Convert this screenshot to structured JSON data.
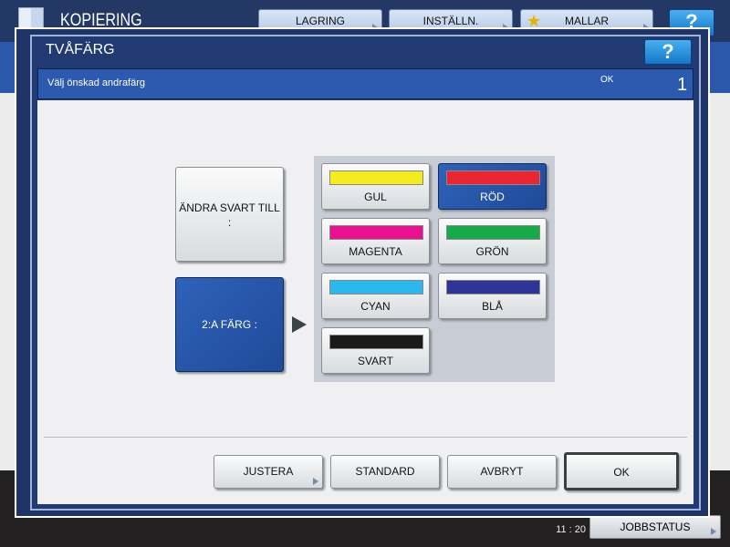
{
  "app": {
    "title": "KOPIERING",
    "icon": "copy-icon"
  },
  "toolbar": {
    "lagring": "LAGRING",
    "installn": "INSTÄLLN.",
    "mallar": "MALLAR",
    "help": "?"
  },
  "dialog": {
    "title": "TVÅFÄRG",
    "help": "?",
    "header": {
      "message": "Välj önskad andrafärg",
      "ok": "OK",
      "count": "1"
    },
    "change_black_label": "ÄNDRA SVART TILL\n:",
    "second_color_label": "2:A FÄRG :",
    "colors": [
      {
        "label": "GUL",
        "color": "#f4ec1c",
        "selected": false
      },
      {
        "label": "RÖD",
        "color": "#ea2630",
        "selected": true
      },
      {
        "label": "MAGENTA",
        "color": "#ea1190",
        "selected": false
      },
      {
        "label": "GRÖN",
        "color": "#16aa4a",
        "selected": false
      },
      {
        "label": "CYAN",
        "color": "#2bb8ec",
        "selected": false
      },
      {
        "label": "BLÅ",
        "color": "#2f3597",
        "selected": false
      },
      {
        "label": "SVART",
        "color": "#1a1a1a",
        "selected": false
      }
    ],
    "buttons": {
      "justera": "JUSTERA",
      "standard": "STANDARD",
      "avbryt": "AVBRYT",
      "ok": "OK"
    }
  },
  "status": {
    "time": "11 : 20",
    "jobbstatus": "JOBBSTATUS"
  }
}
